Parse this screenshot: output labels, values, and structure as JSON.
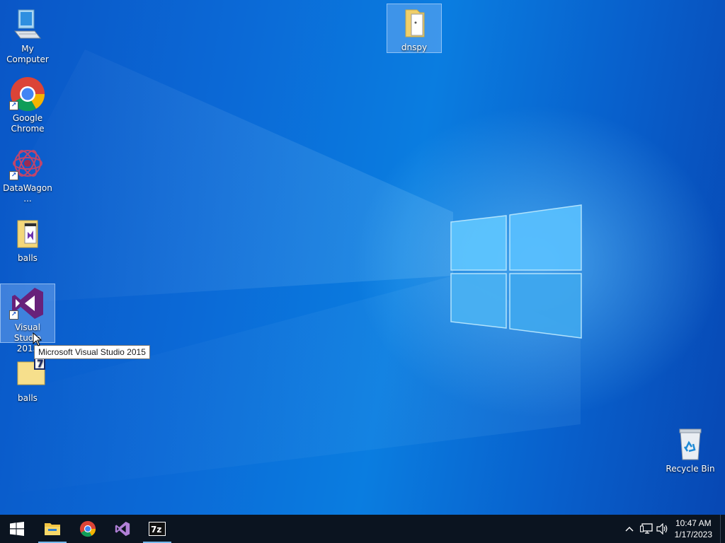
{
  "desktop": {
    "icons": [
      {
        "label": "My Computer",
        "icon": "computer-icon"
      },
      {
        "label": "Google Chrome",
        "icon": "chrome-icon"
      },
      {
        "label": "DataWagon...",
        "icon": "datawagon-icon"
      },
      {
        "label": "balls",
        "icon": "vs-folder-icon"
      },
      {
        "label": "Visual Studio 2015",
        "icon": "visual-studio-icon"
      },
      {
        "label": "balls",
        "icon": "7zip-folder-icon"
      },
      {
        "label": "dnspy",
        "icon": "folder-icon"
      },
      {
        "label": "Recycle Bin",
        "icon": "recycle-bin-icon"
      }
    ],
    "tooltip": "Microsoft Visual Studio 2015"
  },
  "taskbar": {
    "items": [
      "start-icon",
      "file-explorer-icon",
      "chrome-icon",
      "visual-studio-icon",
      "7zip-icon"
    ],
    "tray": [
      "chevron-up-icon",
      "network-icon",
      "volume-icon"
    ],
    "time": "10:47 AM",
    "date": "1/17/2023"
  },
  "colors": {
    "accent": "#0a6fdc",
    "taskbar": "#0b1420",
    "highlight": "#76b9ed"
  }
}
